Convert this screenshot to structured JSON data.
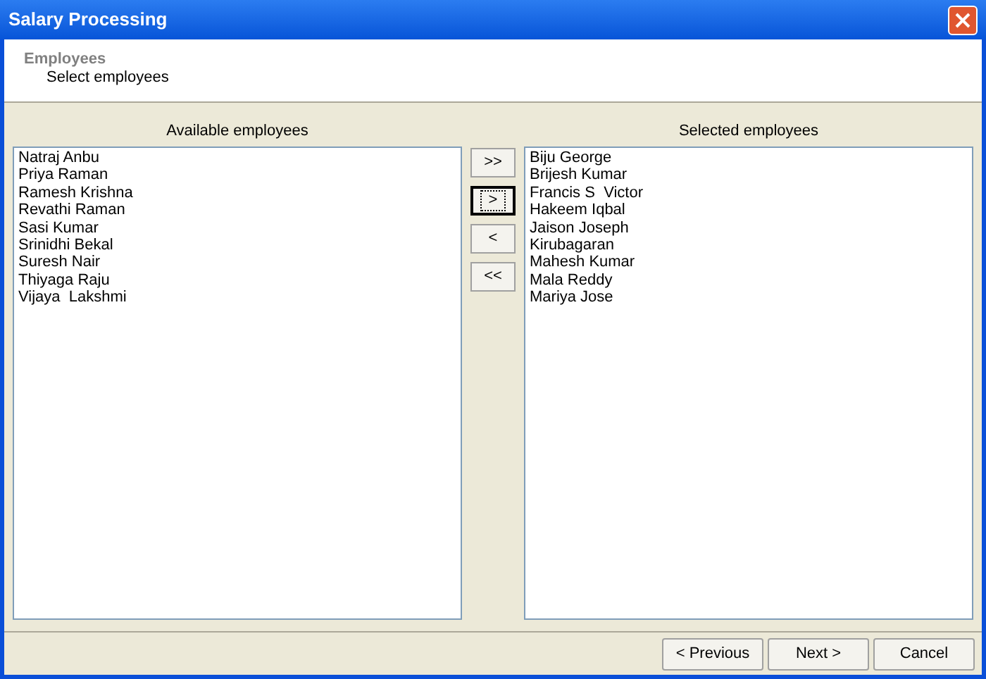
{
  "window": {
    "title": "Salary Processing"
  },
  "header": {
    "title": "Employees",
    "subtitle": "Select employees"
  },
  "available": {
    "label": "Available employees",
    "items": [
      "Natraj Anbu",
      "Priya Raman",
      "Ramesh Krishna",
      "Revathi Raman",
      "Sasi Kumar",
      "Srinidhi Bekal",
      "Suresh Nair",
      "Thiyaga Raju",
      "Vijaya  Lakshmi"
    ]
  },
  "move_buttons": [
    {
      "label": ">>",
      "focused": false
    },
    {
      "label": ">",
      "focused": true
    },
    {
      "label": "<",
      "focused": false
    },
    {
      "label": "<<",
      "focused": false
    }
  ],
  "selected": {
    "label": "Selected employees",
    "items": [
      "Biju George",
      "Brijesh Kumar",
      "Francis S  Victor",
      "Hakeem Iqbal",
      "Jaison Joseph",
      "Kirubagaran",
      "Mahesh Kumar",
      "Mala Reddy",
      "Mariya Jose"
    ]
  },
  "buttons": [
    "< Previous",
    "Next >",
    "Cancel"
  ]
}
